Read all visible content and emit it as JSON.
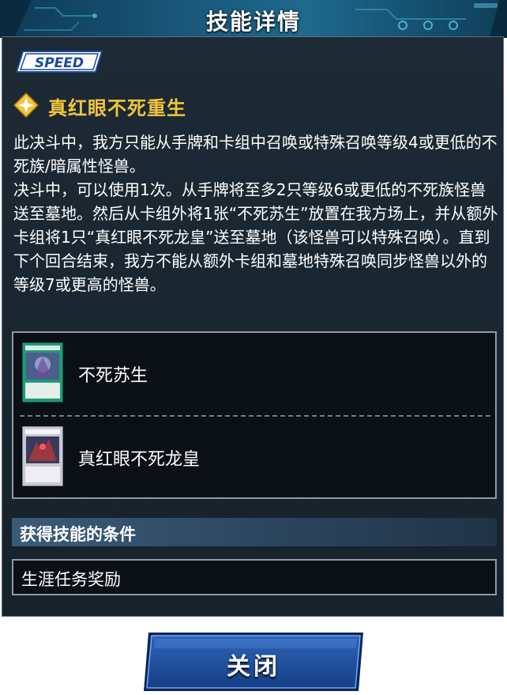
{
  "dialog": {
    "title": "技能详情"
  },
  "skill": {
    "badge": "SPEED",
    "badge_icon": "speed-badge-icon",
    "icon": "diamond-sparkle-icon",
    "name": "真红眼不死重生",
    "description": "此决斗中，我方只能从手牌和卡组中召唤或特殊召唤等级4或更低的不死族/暗属性怪兽。\n决斗中，可以使用1次。从手牌将至多2只等级6或更低的不死族怪兽送至墓地。然后从卡组外将1张“不死苏生”放置在我方场上，并从额外卡组将1只“真红眼不死龙皇”送至墓地（该怪兽可以特殊召唤）。直到下个回合结束，我方不能从额外卡组和墓地特殊召唤同步怪兽以外的等级7或更高的怪兽。"
  },
  "related_cards": [
    {
      "name": "不死苏生",
      "thumb": "spell-card-thumbnail",
      "frame_color": "#1f9a78"
    },
    {
      "name": "真红眼不死龙皇",
      "thumb": "monster-card-thumbnail",
      "frame_color": "#c9c9d6"
    }
  ],
  "conditions": {
    "header": "获得技能的条件",
    "value": "生涯任务奖励"
  },
  "footer": {
    "close_label": "关闭"
  },
  "colors": {
    "skill_name": "#f2c53d",
    "header_bg": "#1b5a7e",
    "panel_bg": "#1d2a35",
    "button_bg": "#1c4a9a"
  }
}
